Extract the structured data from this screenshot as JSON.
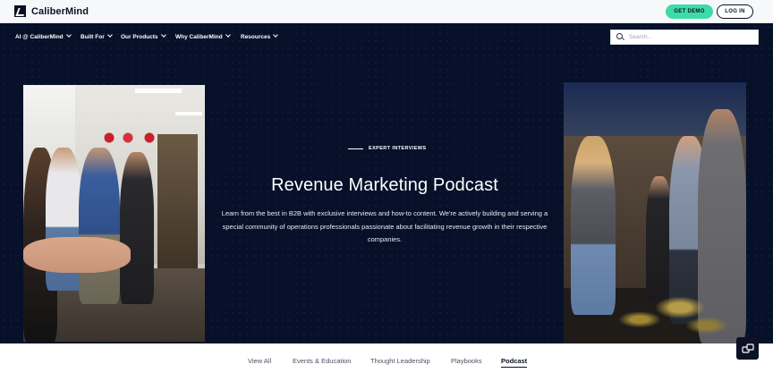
{
  "brand": {
    "name": "CaliberMind"
  },
  "header": {
    "demo_label": "GET DEMO",
    "login_label": "LOG IN"
  },
  "nav": {
    "items": [
      {
        "label": "AI @ CaliberMind"
      },
      {
        "label": "Built For"
      },
      {
        "label": "Our Products"
      },
      {
        "label": "Why CaliberMind"
      },
      {
        "label": "Resources"
      }
    ],
    "search_placeholder": "Search..."
  },
  "hero": {
    "eyebrow": "EXPERT INTERVIEWS",
    "title": "Revenue Marketing Podcast",
    "description": "Learn from the best in B2B with exclusive interviews and how-to content. We're actively building and serving a special community of operations professionals passionate about facilitating revenue growth in their respective companies."
  },
  "tabs": [
    {
      "label": "View All",
      "active": false
    },
    {
      "label": "Events & Education",
      "active": false
    },
    {
      "label": "Thought Leadership",
      "active": false
    },
    {
      "label": "Playbooks",
      "active": false
    },
    {
      "label": "Podcast",
      "active": true
    }
  ],
  "colors": {
    "accent": "#3ddca6",
    "hero_bg": "#061029",
    "text_dark": "#0b1226"
  },
  "icons": {
    "search": "search-icon",
    "chat": "chat-icon",
    "chevron": "chevron-down-icon"
  }
}
